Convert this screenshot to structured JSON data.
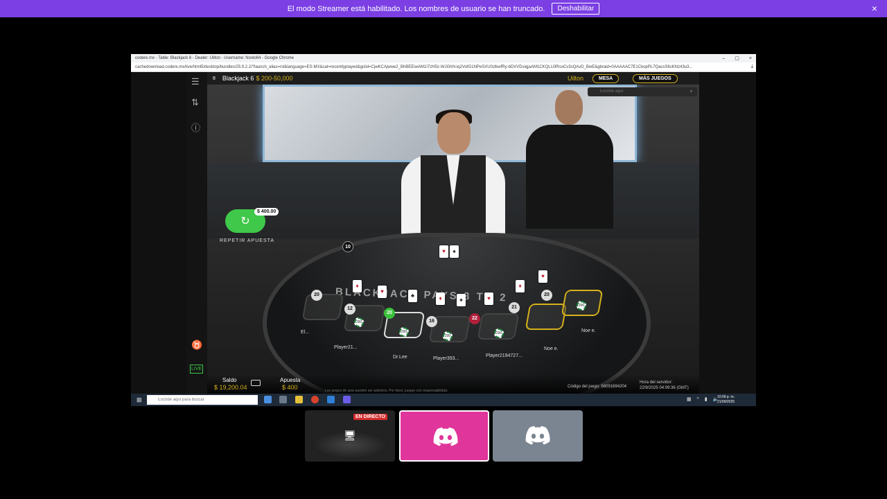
{
  "banner": {
    "message": "El modo Streamer está habilitado. Los nombres de usuario se han truncado.",
    "button_label": "Deshabilitar",
    "close_icon": "×"
  },
  "browser": {
    "title": "codere.mx - Table: Blackjack 6 - Dealer: Uilton - Username: Noxlo64 - Google Chrome",
    "url": "cachedownload.codere.mx/live/html5/desktop/bundles/25.9.2.2/?launch_alias=rsl&language=ES-MX&cat=recentlyplayed&gclid=CjwKCAjwwe2_BhBEEiwAM1I7zH5z-WJGhN-iq2VofG1NPeSXU0zlkwfRy-bDVVDsiqjaAM1CKQLU3RsoCv3sQAvD_BwE&gbraid=0AAAAAC7E1CkopPL7QacsS6cKNz43u3...",
    "min": "–",
    "max": "▢",
    "close": "×"
  },
  "game": {
    "seat_count": "8",
    "table_name": "Blackjack 6",
    "limits": "$ 200-50,000",
    "dealer": "Uilton",
    "mesa_label": "MESA",
    "more_games_label": "MÁS JUEGOS",
    "close": "×",
    "chat_placeholder": "Escribe aquí",
    "chat_plus": "+",
    "table_text": "BLACKJACK PAYS 3 TO 2",
    "rebet_amount": "$ 400.00",
    "rebet_label": "REPETIR APUESTA",
    "deck_count": "10",
    "saldo_label": "Saldo",
    "saldo_value": "$ 19,200.04",
    "apuesta_label": "Apuesta",
    "apuesta_value": "$ 400",
    "disclaimer": "Los juegos de azar pueden ser adictivos. Por favor, juegue con responsabilidad.",
    "game_code": "Código del juego: 56091694204",
    "server_time_label": "Hora del servidor:",
    "server_time": "22/9/2025 04:09:36 (GMT)",
    "scores": [
      "20",
      "12",
      "20",
      "16",
      "22",
      "21",
      "20"
    ],
    "players": [
      "El...",
      "Player21...",
      "Dr.Lee",
      "Player393...",
      "Player2194727...",
      "Noe e.",
      "Noe e."
    ],
    "chip_value": "200"
  },
  "taskbar": {
    "search_placeholder": "Escribe aquí para buscar",
    "time": "10:09 p. m.",
    "date": "21/09/2025"
  },
  "thumbs": {
    "live_badge": "EN DIRECTO"
  },
  "colors": {
    "banner": "#7b3fe4",
    "gold": "#d6b21b",
    "rebet": "#3fc84a",
    "discord_pink": "#e0359a",
    "discord_gray": "#7b8591"
  }
}
